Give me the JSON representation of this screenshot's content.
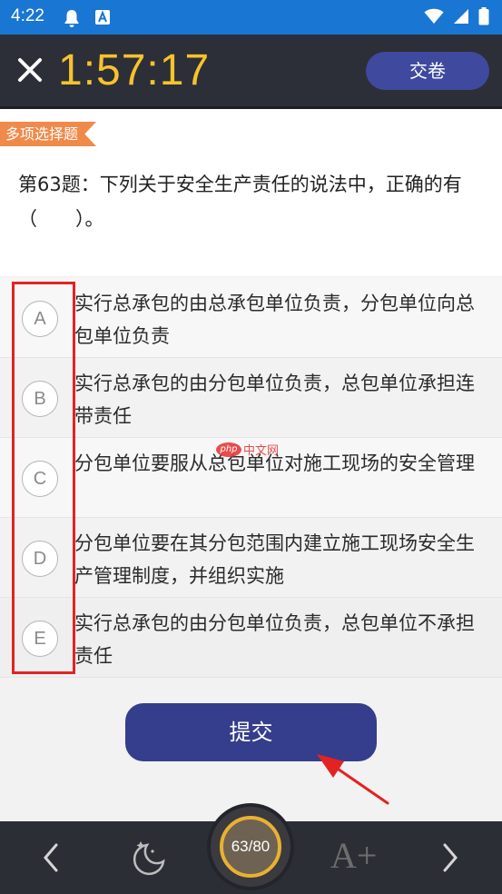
{
  "status_bar": {
    "time": "4:22",
    "icons": [
      "notification-bell-icon",
      "font-a-icon",
      "wifi-icon",
      "signal-icon",
      "battery-icon"
    ]
  },
  "header": {
    "timer": "1:57:17",
    "submit_paper_label": "交卷"
  },
  "question": {
    "type_tag": "多项选择题",
    "text": "第63题：下列关于安全生产责任的说法中，正确的有（　　）。"
  },
  "options": [
    {
      "letter": "A",
      "text": "实行总承包的由总承包单位负责，分包单位向总包单位负责"
    },
    {
      "letter": "B",
      "text": "实行总承包的由分包单位负责，总包单位承担连带责任"
    },
    {
      "letter": "C",
      "text": "分包单位要服从总包单位对施工现场的安全管理"
    },
    {
      "letter": "D",
      "text": "分包单位要在其分包范围内建立施工现场安全生产管理制度，并组织实施"
    },
    {
      "letter": "E",
      "text": "实行总承包的由分包单位负责，总包单位不承担责任"
    }
  ],
  "watermark": {
    "badge": "php",
    "text": "中文网"
  },
  "submit_label": "提交",
  "footer": {
    "progress": "63/80",
    "font_size_label": "A+"
  },
  "colors": {
    "status_bar": "#1976d2",
    "header_bg": "#2c2f37",
    "timer": "#f7c22a",
    "button": "#353e8c",
    "tag": "#f08a4b",
    "highlight": "#e52222"
  }
}
